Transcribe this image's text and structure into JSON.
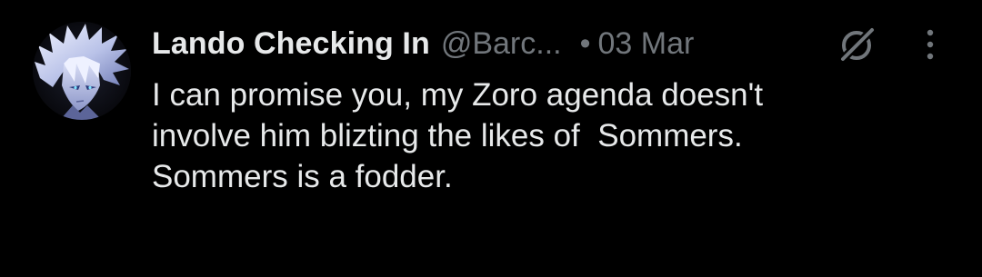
{
  "tweet": {
    "author": {
      "display_name": "Lando Checking In",
      "handle": "@Barc...",
      "avatar_icon": "avatar-anime-character"
    },
    "separator": "•",
    "date": "03 Mar",
    "actions": {
      "grok_icon": "grok-icon",
      "more_icon": "more-vertical-icon"
    },
    "text_lines": [
      "I can promise you, my Zoro agenda doesn't",
      "involve him blizting the likes of  Sommers.",
      "Sommers is a fodder."
    ]
  },
  "colors": {
    "background": "#000000",
    "primary_text": "#e7e9ea",
    "secondary_text": "#71767b"
  }
}
